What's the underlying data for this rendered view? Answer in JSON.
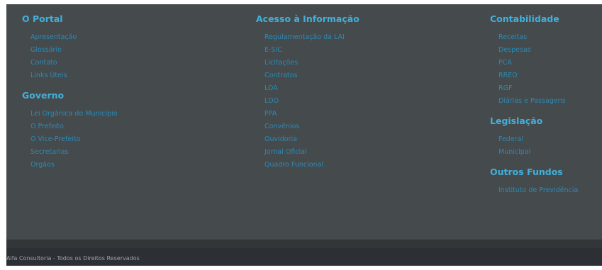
{
  "columns": [
    {
      "sections": [
        {
          "heading": "O Portal",
          "links": [
            "Apresentação",
            "Glossário",
            "Contato",
            "Links Úteis"
          ]
        },
        {
          "heading": "Governo",
          "links": [
            "Lei Orgânica do Município",
            "O Prefeito",
            "O Vice-Prefeito",
            "Secretarias",
            "Orgãos"
          ]
        }
      ]
    },
    {
      "sections": [
        {
          "heading": "Acesso à Informação",
          "links": [
            "Regulamentação da LAI",
            "E-SIC",
            "Licitações",
            "Contratos",
            "LOA",
            "LDO",
            "PPA",
            "Convênios",
            "Ouvidoria",
            "Jornal Oficial",
            "Quadro Funcional"
          ]
        }
      ]
    },
    {
      "sections": [
        {
          "heading": "Contabilidade",
          "links": [
            "Receitas",
            "Despesas",
            "PCA",
            "RREO",
            "RGF",
            "Diárias e Passagens"
          ]
        },
        {
          "heading": "Legislação",
          "links": [
            "Federal",
            "Municipal"
          ]
        },
        {
          "heading": "Outros Fundos",
          "links": [
            "Instituto de Previdência"
          ]
        }
      ]
    }
  ],
  "footer": {
    "copyright": "Alfa Consultoria - Todos os Direitos Reservados"
  },
  "colors": {
    "background": "#454a4d",
    "heading": "#42b0da",
    "link": "#2d8ab4",
    "bottom_bar": "#2c2f33"
  }
}
